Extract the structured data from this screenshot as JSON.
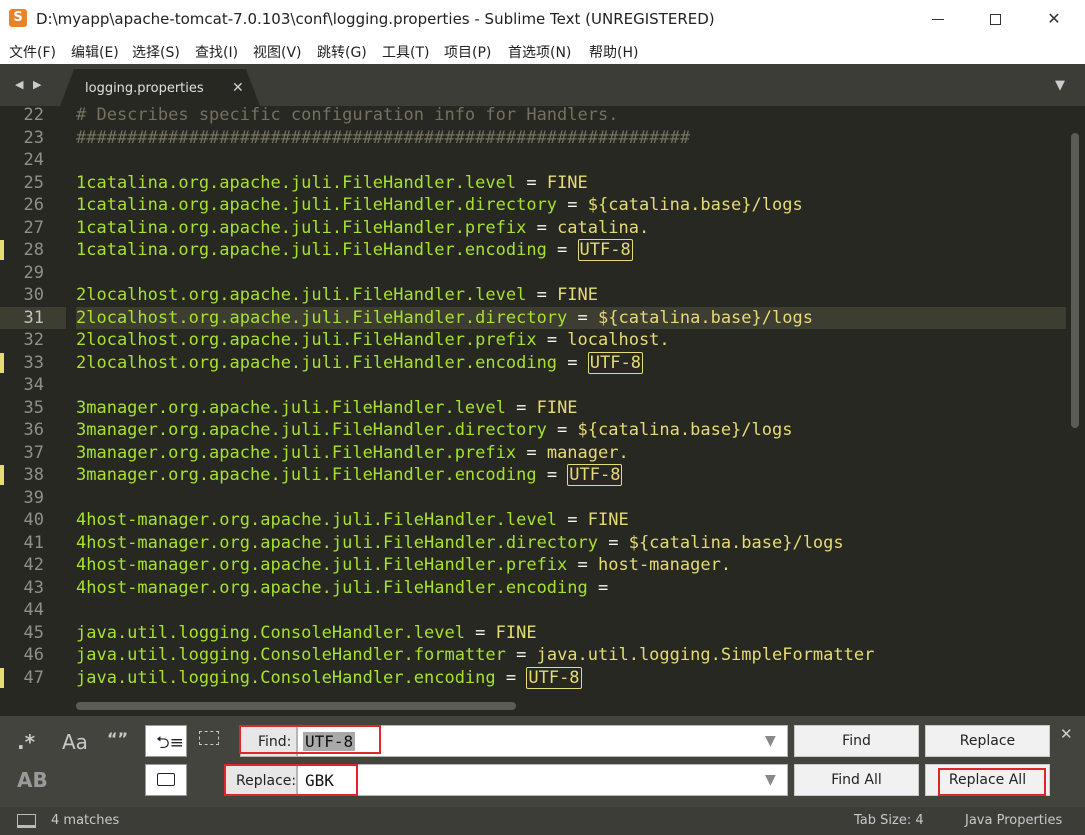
{
  "window": {
    "title": "D:\\myapp\\apache-tomcat-7.0.103\\conf\\logging.properties - Sublime Text (UNREGISTERED)",
    "app_icon": "sublime-icon"
  },
  "menu": [
    "文件(F)",
    "编辑(E)",
    "选择(S)",
    "查找(I)",
    "视图(V)",
    "跳转(G)",
    "工具(T)",
    "项目(P)",
    "首选项(N)",
    "帮助(H)"
  ],
  "tabs": [
    {
      "label": "logging.properties",
      "active": true
    }
  ],
  "editor": {
    "current_line": 31,
    "modified_lines": [
      28,
      33,
      38,
      47
    ],
    "lines": [
      {
        "num": "22",
        "type": "comment",
        "text": "# Describes specific configuration info for Handlers."
      },
      {
        "num": "23",
        "type": "comment",
        "text": "############################################################"
      },
      {
        "num": "24",
        "type": "blank"
      },
      {
        "num": "25",
        "type": "prop",
        "key": "1catalina.org.apache.juli.FileHandler.level",
        "value": "FINE"
      },
      {
        "num": "26",
        "type": "prop",
        "key": "1catalina.org.apache.juli.FileHandler.directory",
        "value": "${catalina.base}/logs"
      },
      {
        "num": "27",
        "type": "prop",
        "key": "1catalina.org.apache.juli.FileHandler.prefix",
        "value": "catalina."
      },
      {
        "num": "28",
        "type": "prop",
        "key": "1catalina.org.apache.juli.FileHandler.encoding",
        "value": "UTF-8",
        "match": true
      },
      {
        "num": "29",
        "type": "blank"
      },
      {
        "num": "30",
        "type": "prop",
        "key": "2localhost.org.apache.juli.FileHandler.level",
        "value": "FINE"
      },
      {
        "num": "31",
        "type": "prop",
        "key": "2localhost.org.apache.juli.FileHandler.directory",
        "value": "${catalina.base}/logs"
      },
      {
        "num": "32",
        "type": "prop",
        "key": "2localhost.org.apache.juli.FileHandler.prefix",
        "value": "localhost."
      },
      {
        "num": "33",
        "type": "prop",
        "key": "2localhost.org.apache.juli.FileHandler.encoding",
        "value": "UTF-8",
        "match": true
      },
      {
        "num": "34",
        "type": "blank"
      },
      {
        "num": "35",
        "type": "prop",
        "key": "3manager.org.apache.juli.FileHandler.level",
        "value": "FINE"
      },
      {
        "num": "36",
        "type": "prop",
        "key": "3manager.org.apache.juli.FileHandler.directory",
        "value": "${catalina.base}/logs"
      },
      {
        "num": "37",
        "type": "prop",
        "key": "3manager.org.apache.juli.FileHandler.prefix",
        "value": "manager."
      },
      {
        "num": "38",
        "type": "prop",
        "key": "3manager.org.apache.juli.FileHandler.encoding",
        "value": "UTF-8",
        "match": true
      },
      {
        "num": "39",
        "type": "blank"
      },
      {
        "num": "40",
        "type": "prop",
        "key": "4host-manager.org.apache.juli.FileHandler.level",
        "value": "FINE"
      },
      {
        "num": "41",
        "type": "prop",
        "key": "4host-manager.org.apache.juli.FileHandler.directory",
        "value": "${catalina.base}/logs"
      },
      {
        "num": "42",
        "type": "prop",
        "key": "4host-manager.org.apache.juli.FileHandler.prefix",
        "value": "host-manager."
      },
      {
        "num": "43",
        "type": "prop",
        "key": "4host-manager.org.apache.juli.FileHandler.encoding",
        "value": ""
      },
      {
        "num": "44",
        "type": "blank"
      },
      {
        "num": "45",
        "type": "prop",
        "key": "java.util.logging.ConsoleHandler.level",
        "value": "FINE"
      },
      {
        "num": "46",
        "type": "prop",
        "key": "java.util.logging.ConsoleHandler.formatter",
        "value": "java.util.logging.SimpleFormatter"
      },
      {
        "num": "47",
        "type": "prop",
        "key": "java.util.logging.ConsoleHandler.encoding",
        "value": "UTF-8",
        "match": true
      }
    ]
  },
  "find_panel": {
    "options": {
      "regex": ".*",
      "case": "Aa",
      "whole_word": "“”",
      "wrap": "wrap-icon",
      "in_selection": "in-selection-icon",
      "preserve_case": "AB",
      "highlight": "highlight-matches-icon"
    },
    "find_label": "Find:",
    "find_value": "UTF-8",
    "replace_label": "Replace:",
    "replace_value": "GBK",
    "buttons": {
      "find": "Find",
      "replace": "Replace",
      "find_all": "Find All",
      "replace_all": "Replace All"
    }
  },
  "status": {
    "matches": "4 matches",
    "tab_size": "Tab Size: 4",
    "syntax": "Java Properties"
  },
  "colors": {
    "background": "#272822",
    "comment": "#75715e",
    "key": "#a6e22e",
    "value": "#e6db74",
    "highlight_outline": "#e0262a"
  }
}
